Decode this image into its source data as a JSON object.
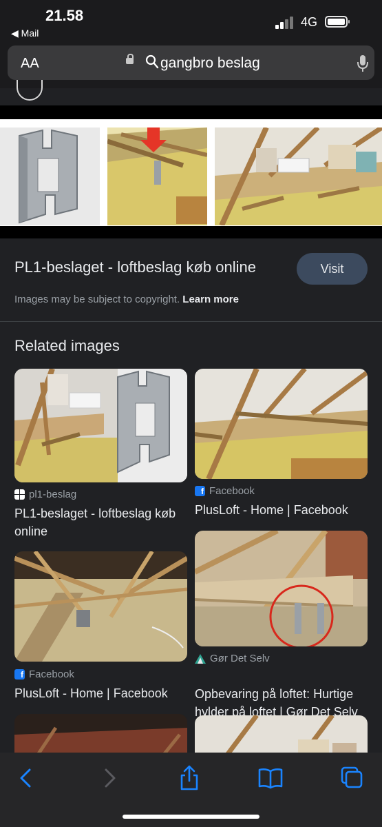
{
  "status_bar": {
    "time": "21.58",
    "back_app": "◀ Mail",
    "network": "4G"
  },
  "address_bar": {
    "text_size_label": "AA",
    "query": "gangbro beslag",
    "icons": [
      "lock-icon",
      "search-icon",
      "microphone-icon"
    ]
  },
  "result": {
    "title": "PL1-beslaget - loftbeslag køb online",
    "visit_label": "Visit",
    "copyright_text": "Images may be subject to copyright.",
    "learn_more_label": "Learn more"
  },
  "related": {
    "heading": "Related images",
    "items": [
      {
        "source": "pl1-beslag",
        "caption_line1": "PL1-beslaget - loftbeslag køb",
        "caption_line2": "online",
        "favicon": "pl1-favicon"
      },
      {
        "source": "Facebook",
        "caption_line1": "PlusLoft - Home | Facebook",
        "caption_line2": "",
        "favicon": "facebook-favicon"
      },
      {
        "source": "Facebook",
        "caption_line1": "PlusLoft - Home | Facebook",
        "caption_line2": "",
        "favicon": "facebook-favicon"
      },
      {
        "source": "Gør Det Selv",
        "caption_line1": "Opbevaring på loftet: Hurtige",
        "caption_line2": "hylder på loftet | Gør Det Selv",
        "favicon": "gor-det-selv-favicon"
      }
    ]
  },
  "toolbar": {
    "buttons": [
      "back-icon",
      "forward-icon",
      "share-icon",
      "bookmarks-icon",
      "tabs-icon"
    ]
  },
  "colors": {
    "page_background": "#202124",
    "visit_button": "#3c4a5e",
    "facebook_blue": "#1877f2",
    "muted_text": "#9aa0a6"
  }
}
